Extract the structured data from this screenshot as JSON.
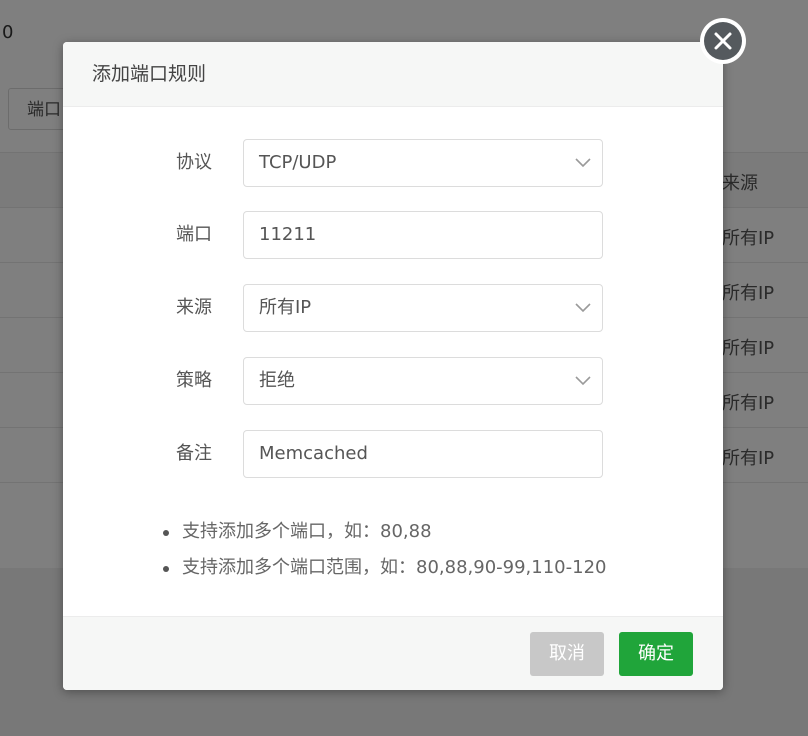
{
  "background": {
    "top_value": "0",
    "tab_label": "端口",
    "table_header_source": "来源",
    "rows": [
      {
        "source": "所有IP"
      },
      {
        "source": "所有IP"
      },
      {
        "source": "所有IP"
      },
      {
        "source": "所有IP"
      },
      {
        "source": "所有IP"
      }
    ]
  },
  "dialog": {
    "title": "添加端口规则",
    "fields": {
      "protocol": {
        "label": "协议",
        "value": "TCP/UDP"
      },
      "port": {
        "label": "端口",
        "value": "11211"
      },
      "source": {
        "label": "来源",
        "value": "所有IP"
      },
      "policy": {
        "label": "策略",
        "value": "拒绝"
      },
      "remark": {
        "label": "备注",
        "value": "Memcached"
      }
    },
    "tips": [
      "支持添加多个端口，如：80,88",
      "支持添加多个端口范围，如：80,88,90-99,110-120"
    ],
    "buttons": {
      "cancel": "取消",
      "ok": "确定"
    }
  },
  "colors": {
    "primary_green": "#20a53a",
    "cancel_gray": "#c8c8c8",
    "close_icon_bg": "#555a5e"
  },
  "icons": {
    "close": "close-circle-icon",
    "select_arrow": "chevron-down-icon"
  }
}
